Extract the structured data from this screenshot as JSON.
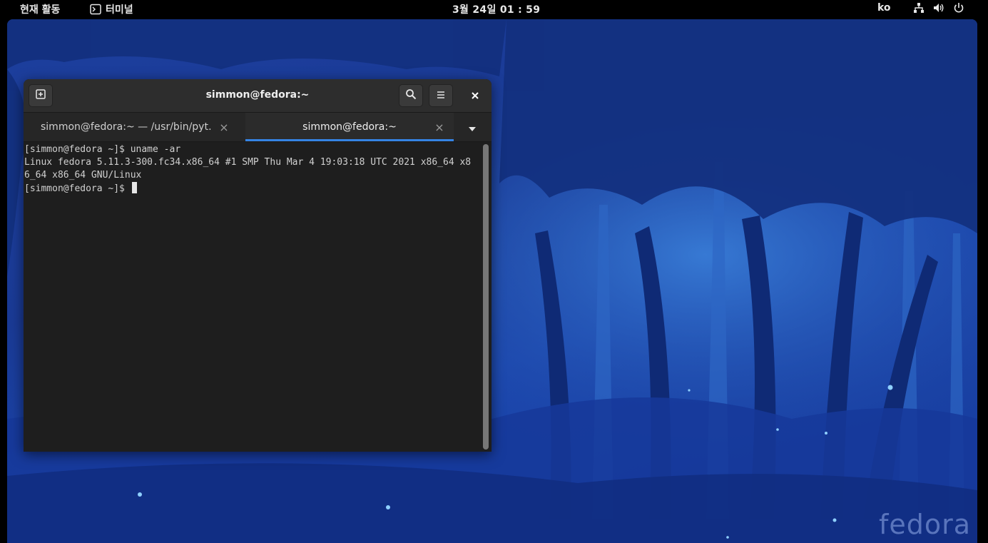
{
  "topbar": {
    "activities": "현재 활동",
    "app_menu": "터미널",
    "clock": "3월 24일  01 : 59",
    "language": "ko",
    "icons": [
      "network-icon",
      "volume-icon",
      "power-icon"
    ]
  },
  "desktop": {
    "watermark": "fedora"
  },
  "terminal": {
    "title": "simmon@fedora:~",
    "tabs": [
      {
        "label": "simmon@fedora:~ — /usr/bin/pyt…",
        "active": false
      },
      {
        "label": "simmon@fedora:~",
        "active": true
      }
    ],
    "lines": [
      "[simmon@fedora ~]$ uname -ar",
      "Linux fedora 5.11.3-300.fc34.x86_64 #1 SMP Thu Mar 4 19:03:18 UTC 2021 x86_64 x8",
      "6_64 x86_64 GNU/Linux",
      "[simmon@fedora ~]$ "
    ],
    "tab_close_glyph": "×",
    "colors": {
      "accent": "#3584e4",
      "background": "#1e1e1e",
      "header": "#2d2d2d"
    }
  }
}
